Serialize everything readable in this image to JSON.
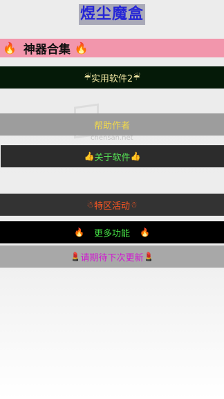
{
  "app": {
    "title": "煜尘魔盒"
  },
  "header": {
    "icon_left": "🔥",
    "label": "神器合集",
    "icon_right": "🔥"
  },
  "buttons": [
    {
      "icon_left": "☔",
      "label": "实用软件2",
      "icon_right": "☔"
    },
    {
      "icon_left": "",
      "label": "帮助作者",
      "icon_right": ""
    },
    {
      "icon_left": "👍",
      "label": "关于软件",
      "icon_right": "👍"
    },
    {
      "icon_left": "☃",
      "label": "特区活动",
      "icon_right": "☃"
    },
    {
      "icon_left": "🔥",
      "label": "更多功能",
      "icon_right": "🔥"
    },
    {
      "icon_left": "💄",
      "label": "请期待下次更新",
      "icon_right": "💄"
    }
  ],
  "watermark": {
    "logo_text": "晨三网",
    "url": "chensan.net"
  }
}
